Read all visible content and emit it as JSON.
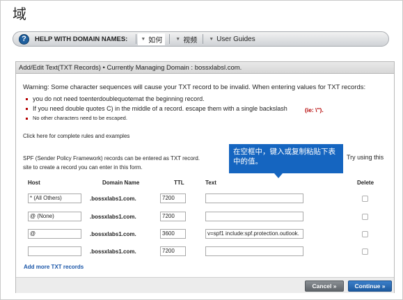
{
  "page": {
    "title": "域"
  },
  "help_bar": {
    "label": "HELP WITH DOMAIN NAMES:",
    "links": [
      "如何",
      "视频",
      "User Guides"
    ]
  },
  "dialog": {
    "header": "Add/Edit Text(TXT Records) • Currently Managing Domain : bossxlabsl.com.",
    "warning": "Warning: Some character sequences will cause your TXT record to be invalid. When entering values for TXT records:",
    "bullets": [
      "you do not need toenterdoublequotemat the beginning record.",
      "If you need double quotes C) in the middle of a record. escape them with a single backslash",
      "No other characters need to be escaped."
    ],
    "ie_note": "(ie: \\\").",
    "rules_link": "Click here for complete rules and examples",
    "spf_line1": "SPF (Sender Policy Framework) records can be entered as TXT record.",
    "spf_line2": "site to create a record you can enter in this form.",
    "spf_right": "Try using this",
    "tooltip": "在空框中，键入或复制粘贴下表中的值。",
    "columns": {
      "host": "Host",
      "domain": "Domain Name",
      "ttl": "TTL",
      "text": "Text",
      "delete": "Delete"
    },
    "rows": [
      {
        "host": "* (All Others)",
        "domain": ".bossxlabs1.com.",
        "ttl": "7200",
        "text": ""
      },
      {
        "host": "@ (None)",
        "domain": ".bossxlabs1.com.",
        "ttl": "7200",
        "text": ""
      },
      {
        "host": "@",
        "domain": ".bossxlabs1.com.",
        "ttl": "3600",
        "text": "v=spf1 include:spf.protection.outlook."
      },
      {
        "host": "",
        "domain": ".bossxlabs1.com.",
        "ttl": "7200",
        "text": ""
      }
    ],
    "add_more": "Add more TXT records",
    "cancel_label": "Cancel »",
    "continue_label": "Continue »"
  },
  "colors": {
    "accent": "#1565c0",
    "warning_red": "#b40000",
    "link_blue": "#1a56a8"
  }
}
